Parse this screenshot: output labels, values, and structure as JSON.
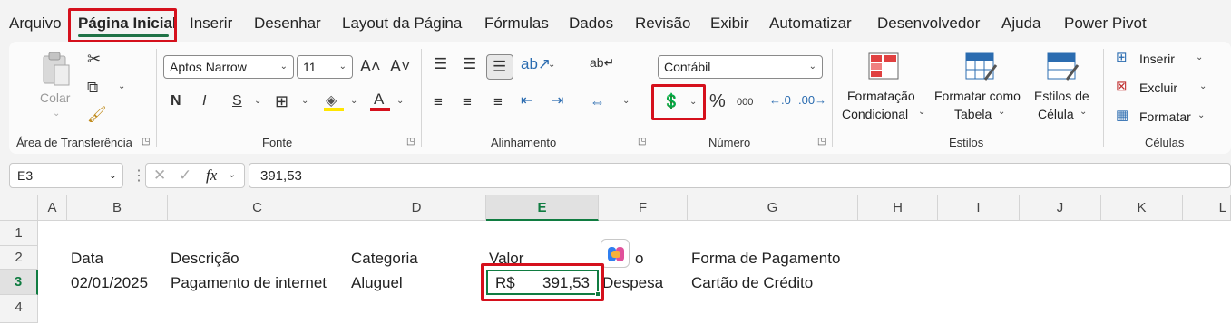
{
  "tabs": [
    "Arquivo",
    "Página Inicial",
    "Inserir",
    "Desenhar",
    "Layout da Página",
    "Fórmulas",
    "Dados",
    "Revisão",
    "Exibir",
    "Automatizar",
    "Desenvolvedor",
    "Ajuda",
    "Power Pivot"
  ],
  "active_tab": "Página Inicial",
  "ribbon": {
    "clipboard": {
      "paste_label": "Colar",
      "group_label": "Área de Transferência"
    },
    "font": {
      "font_name": "Aptos Narrow",
      "font_size": "11",
      "bold": "N",
      "italic": "I",
      "underline": "S",
      "group_label": "Fonte"
    },
    "alignment": {
      "group_label": "Alinhamento"
    },
    "number": {
      "format": "Contábil",
      "percent": "%",
      "thousands": "000",
      "group_label": "Número"
    },
    "styles": {
      "conditional_line1": "Formatação",
      "conditional_line2": "Condicional",
      "table_line1": "Formatar como",
      "table_line2": "Tabela",
      "cell_styles_line1": "Estilos de",
      "cell_styles_line2": "Célula",
      "group_label": "Estilos"
    },
    "cells": {
      "insert": "Inserir",
      "delete": "Excluir",
      "format": "Formatar",
      "group_label": "Células"
    }
  },
  "formula_bar": {
    "name_box": "E3",
    "fx": "fx",
    "value": "391,53"
  },
  "columns": [
    "A",
    "B",
    "C",
    "D",
    "E",
    "F",
    "G",
    "H",
    "I",
    "J",
    "K",
    "L"
  ],
  "rows": [
    "1",
    "2",
    "3",
    "4"
  ],
  "sheet": {
    "headers": {
      "data": "Data",
      "descricao": "Descrição",
      "categoria": "Categoria",
      "valor": "Valor",
      "tipo_fragment": "o",
      "forma": "Forma de Pagamento"
    },
    "row3": {
      "data": "02/01/2025",
      "descricao": "Pagamento de internet",
      "categoria": "Aluguel",
      "currency": "R$",
      "valor": "391,53",
      "tipo": "Despesa",
      "forma": "Cartão de Crédito"
    }
  },
  "colors": {
    "accent": "#107c41",
    "highlight": "#d5101c"
  }
}
